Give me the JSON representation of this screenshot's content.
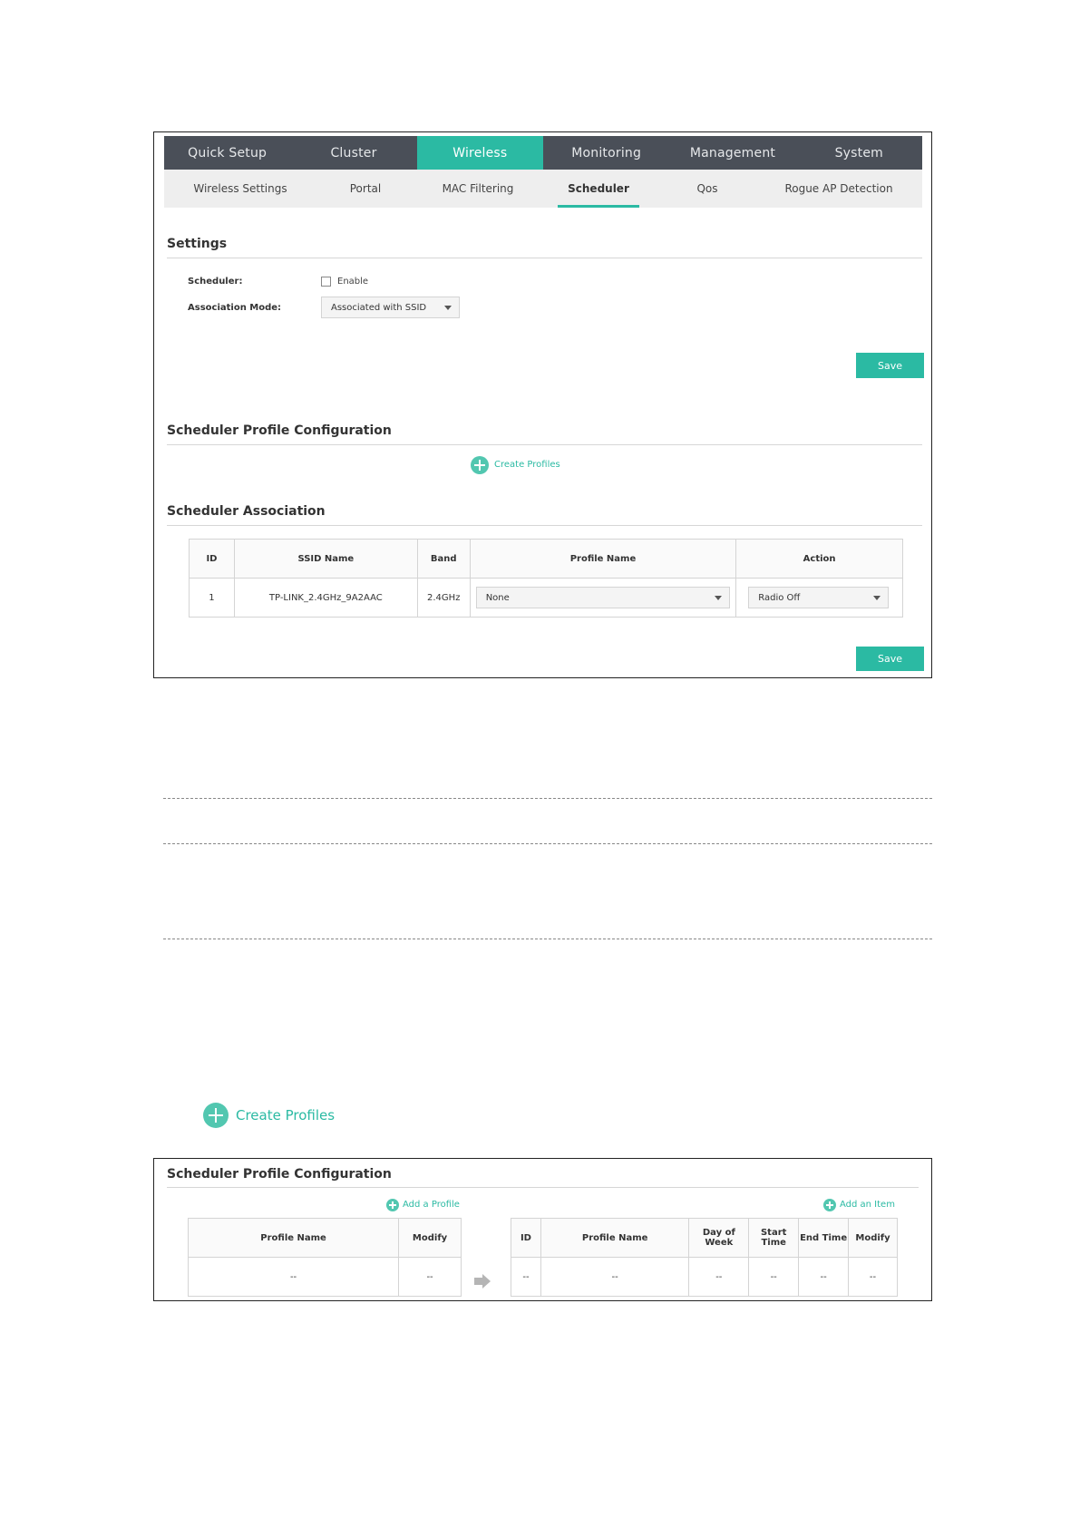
{
  "nav": {
    "tabs": [
      "Quick Setup",
      "Cluster",
      "Wireless",
      "Monitoring",
      "Management",
      "System"
    ],
    "active_tab": "Wireless",
    "subtabs": [
      "Wireless Settings",
      "Portal",
      "MAC Filtering",
      "Scheduler",
      "Qos",
      "Rogue AP Detection"
    ],
    "active_subtab": "Scheduler"
  },
  "settings": {
    "title": "Settings",
    "scheduler_label": "Scheduler:",
    "enable_label": "Enable",
    "association_mode_label": "Association Mode:",
    "association_mode_value": "Associated with SSID",
    "save_label": "Save"
  },
  "profile_config": {
    "title": "Scheduler Profile Configuration",
    "create_profiles_label": "Create Profiles"
  },
  "association": {
    "title": "Scheduler Association",
    "headers": [
      "ID",
      "SSID Name",
      "Band",
      "Profile Name",
      "Action"
    ],
    "rows": [
      {
        "id": "1",
        "ssid": "TP-LINK_2.4GHz_9A2AAC",
        "band": "2.4GHz",
        "profile": "None",
        "action": "Radio Off"
      }
    ],
    "save_label": "Save"
  },
  "standalone_create": {
    "label": "Create Profiles"
  },
  "profile_config2": {
    "title": "Scheduler Profile Configuration",
    "add_profile_label": "Add a Profile",
    "add_item_label": "Add an Item",
    "left_headers": [
      "Profile Name",
      "Modify"
    ],
    "left_row": [
      "--",
      "--"
    ],
    "right_headers": [
      "ID",
      "Profile Name",
      "Day of Week",
      "Start Time",
      "End Time",
      "Modify"
    ],
    "right_row": [
      "--",
      "--",
      "--",
      "--",
      "--",
      "--"
    ]
  },
  "colors": {
    "accent": "#2bbaa3",
    "nav_bg": "#4a4f58"
  }
}
